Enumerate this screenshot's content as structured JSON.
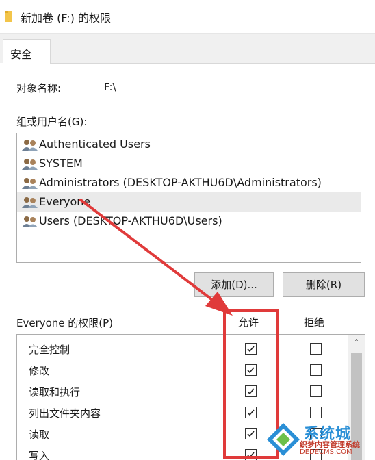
{
  "window": {
    "title": "新加卷 (F:) 的权限"
  },
  "tabs": [
    {
      "label": "安全"
    }
  ],
  "object": {
    "label": "对象名称:",
    "value": "F:\\"
  },
  "group_list": {
    "label": "组或用户名(G):",
    "items": [
      {
        "name": "Authenticated Users",
        "selected": false
      },
      {
        "name": "SYSTEM",
        "selected": false
      },
      {
        "name": "Administrators (DESKTOP-AKTHU6D\\Administrators)",
        "selected": false
      },
      {
        "name": "Everyone",
        "selected": true
      },
      {
        "name": "Users (DESKTOP-AKTHU6D\\Users)",
        "selected": false
      }
    ]
  },
  "buttons": {
    "add": "添加(D)...",
    "remove": "删除(R)"
  },
  "permissions": {
    "label": "Everyone 的权限(P)",
    "allow_header": "允许",
    "deny_header": "拒绝",
    "rows": [
      {
        "name": "完全控制",
        "allow": true,
        "deny": false
      },
      {
        "name": "修改",
        "allow": true,
        "deny": false
      },
      {
        "name": "读取和执行",
        "allow": true,
        "deny": false
      },
      {
        "name": "列出文件夹内容",
        "allow": true,
        "deny": false
      },
      {
        "name": "读取",
        "allow": true,
        "deny": false
      },
      {
        "name": "写入",
        "allow": true,
        "deny": false
      }
    ]
  },
  "annotation": {
    "color": "#e03a3a"
  },
  "watermark": {
    "brand": "系统城",
    "line1": "织梦内容管理系统",
    "line2": "DEDECMS.COM"
  },
  "icons": {
    "folder": "folder-icon",
    "user_group": "user-group-icon",
    "checkbox_checked": "checkmark-icon",
    "scroll_up": "scroll-up-arrow-icon"
  }
}
